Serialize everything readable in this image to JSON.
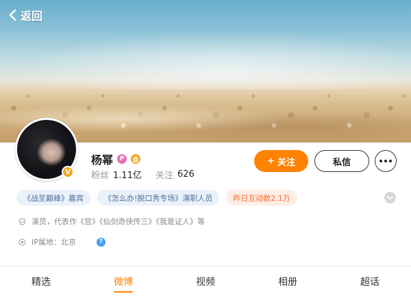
{
  "header": {
    "back_label": "返回"
  },
  "profile": {
    "name": "杨幂",
    "badges": [
      "P",
      "会"
    ],
    "verified_mark": "V",
    "stats": [
      {
        "label": "粉丝",
        "value": "1.11亿"
      },
      {
        "label": "关注",
        "value": "626"
      }
    ]
  },
  "actions": {
    "follow_label": "关注",
    "follow_plus": "+",
    "message_label": "私信"
  },
  "tags": [
    {
      "text": "《战至巅峰》嘉宾",
      "style": "blue"
    },
    {
      "text": "《怎么办!脱口秀专场》演职人员",
      "style": "blue"
    },
    {
      "text": "昨日互动数2.1万",
      "style": "orange"
    }
  ],
  "info": {
    "works": "演员，代表作《宫》《仙剑奇侠传三》《我是证人》等",
    "ip_location": "IP属地：北京",
    "help_mark": "?"
  },
  "tabs": [
    {
      "label": "精选",
      "active": false
    },
    {
      "label": "微博",
      "active": true
    },
    {
      "label": "视频",
      "active": false
    },
    {
      "label": "相册",
      "active": false
    },
    {
      "label": "超话",
      "active": false
    }
  ],
  "colors": {
    "accent": "#ff8200",
    "tag_blue_text": "#4f6f9a",
    "tag_orange_text": "#ff6a2b",
    "help_blue": "#49a0f7"
  },
  "icons": {
    "back": "chevron-left-icon",
    "more": "more-dots-icon",
    "expand": "chevron-down-icon",
    "works": "shield-icon",
    "ip": "location-icon",
    "help": "question-icon"
  }
}
